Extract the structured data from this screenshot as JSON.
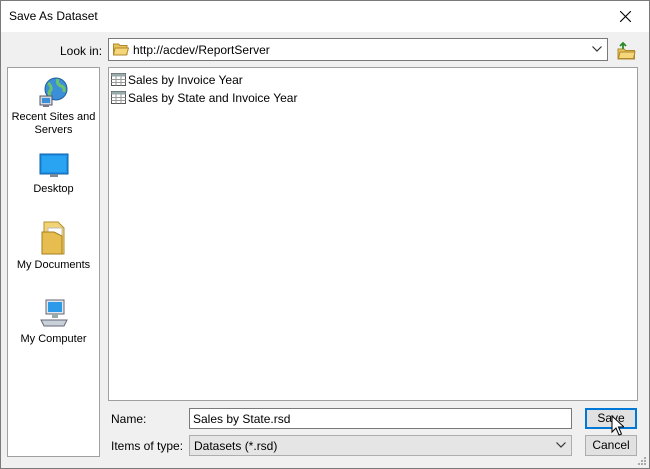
{
  "window": {
    "title": "Save As Dataset",
    "close_icon": "close-icon"
  },
  "lookin": {
    "label": "Look in:",
    "value": "http://acdev/ReportServer",
    "up_icon": "up-folder-icon"
  },
  "places": [
    {
      "label": "Recent Sites and Servers",
      "icon": "network-globe-icon"
    },
    {
      "label": "Desktop",
      "icon": "desktop-icon"
    },
    {
      "label": "My Documents",
      "icon": "documents-folder-icon"
    },
    {
      "label": "My Computer",
      "icon": "computer-icon"
    }
  ],
  "files": [
    {
      "name": "Sales by Invoice Year",
      "icon": "dataset-icon"
    },
    {
      "name": "Sales by State and Invoice Year",
      "icon": "dataset-icon"
    }
  ],
  "name_field": {
    "label": "Name:",
    "value": "Sales by State.rsd"
  },
  "type_field": {
    "label": "Items of type:",
    "value": "Datasets (*.rsd)"
  },
  "buttons": {
    "save": "Save",
    "cancel": "Cancel"
  },
  "colors": {
    "accent": "#0078d7",
    "background": "#f0f0f0"
  }
}
